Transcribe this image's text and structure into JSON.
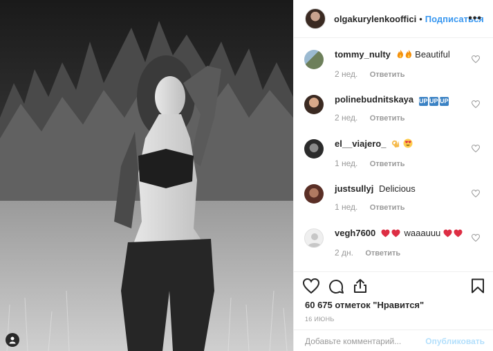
{
  "post": {
    "username": "olgakurylenkooffici",
    "separator": "•",
    "follow_label": "Подписаться",
    "more_label": "•••",
    "likes_text": "60 675 отметок \"Нравится\"",
    "date_text": "16 ИЮНЬ"
  },
  "comments": [
    {
      "user": "tommy_nulty",
      "text": "Beautiful",
      "emoji": "fire-fire",
      "time": "2 нед.",
      "reply": "Ответить"
    },
    {
      "user": "polinebudnitskaya",
      "text": "",
      "emoji": "up-up-up",
      "time": "2 нед.",
      "reply": "Ответить"
    },
    {
      "user": "el__viajero_",
      "text": "",
      "emoji": "ok-hearteyes",
      "time": "1 нед.",
      "reply": "Ответить"
    },
    {
      "user": "justsullyj",
      "text": "Delicious",
      "emoji": "",
      "time": "1 нед.",
      "reply": "Ответить"
    },
    {
      "user": "vegh7600",
      "text": "waaauuu",
      "emoji": "hearts",
      "time": "2 дн.",
      "reply": "Ответить"
    }
  ],
  "composer": {
    "placeholder": "Добавьте комментарий...",
    "publish_label": "Опубликовать"
  },
  "emoji_text": {
    "up": "UP"
  },
  "colors": {
    "link_blue": "#3897f0",
    "publish_disabled": "#b2dffc",
    "meta_gray": "#999999",
    "heart_red": "#dd2e44"
  },
  "icons": [
    "heart-icon",
    "comment-icon",
    "share-icon",
    "bookmark-icon",
    "like-heart-icon",
    "person-tag-icon"
  ]
}
